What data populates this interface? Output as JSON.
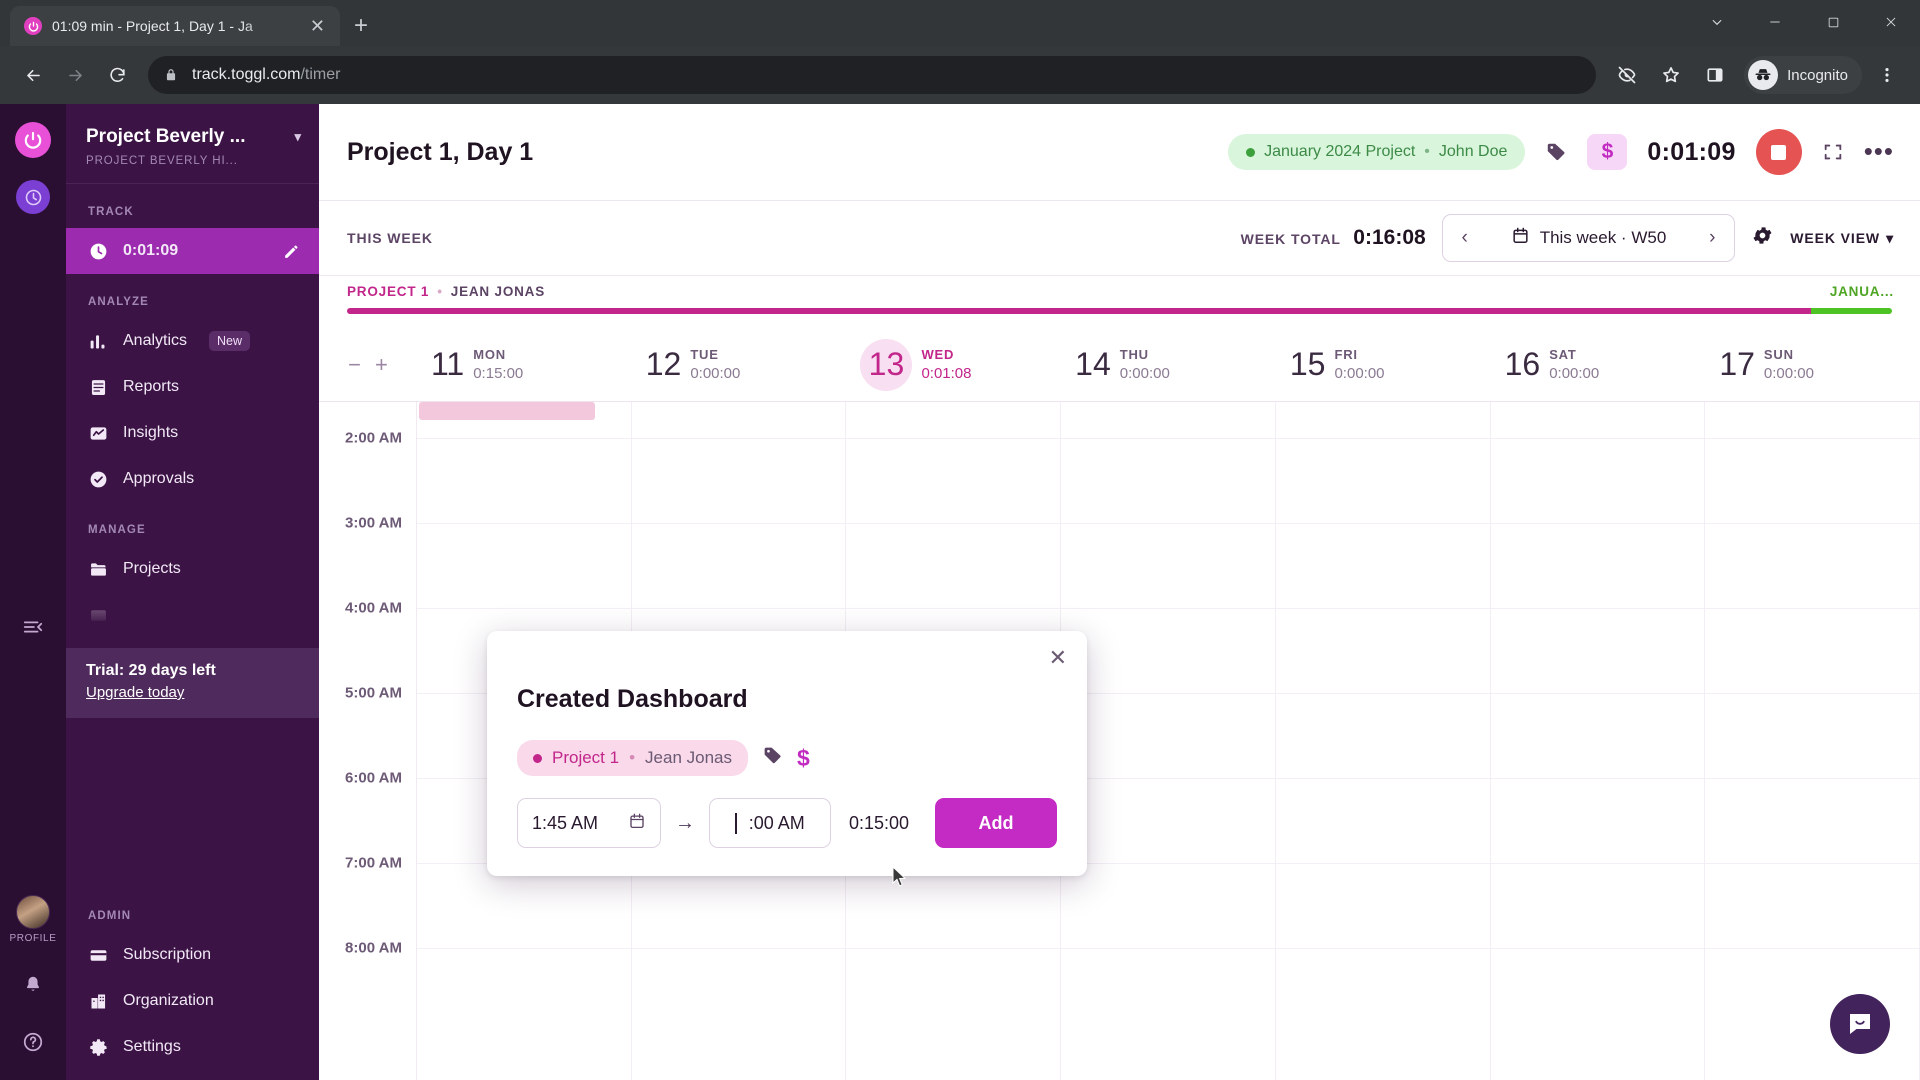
{
  "browser": {
    "tab": {
      "title": "01:09 min - Project 1, Day 1 - Ja",
      "favicon_icon": "toggl-power-icon",
      "close_icon": "close-icon"
    },
    "new_tab_icon": "plus-icon",
    "window_controls": {
      "minimize": "minimize-icon",
      "maximize": "maximize-icon",
      "close": "close-icon",
      "tab_search": "chevron-down-icon"
    },
    "nav": {
      "back": "back-arrow-icon",
      "forward": "forward-arrow-icon",
      "reload": "reload-icon"
    },
    "omnibox": {
      "lock_icon": "lock-icon",
      "url_host": "track.toggl.com",
      "url_path": "/timer"
    },
    "toolbar_icons": {
      "tracking_protection": "eye-off-icon",
      "bookmark": "star-icon",
      "side_panel": "side-panel-icon",
      "menu": "three-dot-menu-icon"
    },
    "profile": {
      "label": "Incognito",
      "icon": "incognito-icon"
    }
  },
  "rail": {
    "logo_icon": "toggl-power-icon",
    "app_switcher_icon": "toggl-track-icon",
    "collapse_icon": "collapse-sidebar-icon",
    "profile_caption": "PROFILE",
    "avatar_icon": "user-avatar",
    "notifications_icon": "bell-icon",
    "help_icon": "help-circle-icon"
  },
  "sidebar": {
    "workspace_title": "Project Beverly ...",
    "workspace_chevron": "chevron-down-icon",
    "workspace_subtitle": "PROJECT BEVERLY HI...",
    "sections": [
      {
        "label": "TRACK",
        "items": [
          {
            "label": "0:01:09",
            "icon": "clock-icon",
            "active": true,
            "trailing_icon": "pencil-icon"
          }
        ]
      },
      {
        "label": "ANALYZE",
        "items": [
          {
            "label": "Analytics",
            "icon": "bar-chart-icon",
            "badge": "New"
          },
          {
            "label": "Reports",
            "icon": "document-icon"
          },
          {
            "label": "Insights",
            "icon": "insights-icon"
          },
          {
            "label": "Approvals",
            "icon": "check-circle-icon"
          }
        ]
      },
      {
        "label": "MANAGE",
        "items": [
          {
            "label": "Projects",
            "icon": "folder-icon"
          }
        ]
      }
    ],
    "trial": {
      "text": "Trial: 29 days left",
      "link": "Upgrade today"
    },
    "admin": {
      "label": "ADMIN",
      "items": [
        {
          "label": "Subscription",
          "icon": "credit-card-icon"
        },
        {
          "label": "Organization",
          "icon": "building-icon"
        },
        {
          "label": "Settings",
          "icon": "gear-icon"
        }
      ]
    }
  },
  "app_header": {
    "entry_title": "Project 1, Day 1",
    "project_pill": {
      "project": "January 2024 Project",
      "separator": "•",
      "member": "John Doe",
      "dot_color": "#3ca03c"
    },
    "tag_icon": "tag-icon",
    "billable_icon": "dollar-icon",
    "timer": "0:01:09",
    "stop_icon": "stop-icon",
    "fullscreen_icon": "fullscreen-icon",
    "more_icon": "three-dot-menu-icon"
  },
  "week_bar": {
    "this_week_label": "THIS WEEK",
    "week_total_label": "WEEK TOTAL",
    "week_total_value": "0:16:08",
    "prev_icon": "chevron-left-icon",
    "next_icon": "chevron-right-icon",
    "calendar_icon": "calendar-icon",
    "picker_label": "This week · W50",
    "settings_icon": "gear-icon",
    "view_label": "WEEK VIEW",
    "view_chevron": "chevron-down-icon"
  },
  "project_strip": {
    "project": "PROJECT 1",
    "separator": "•",
    "member": "JEAN JONAS",
    "right_label": "JANUA...",
    "bar_primary_color": "#c2268a",
    "bar_secondary_color": "#4ec424"
  },
  "zoom_controls": {
    "out": "−",
    "in": "+"
  },
  "days": [
    {
      "num": "11",
      "dow": "MON",
      "dur": "0:15:00",
      "today": false
    },
    {
      "num": "12",
      "dow": "TUE",
      "dur": "0:00:00",
      "today": false
    },
    {
      "num": "13",
      "dow": "WED",
      "dur": "0:01:08",
      "today": true
    },
    {
      "num": "14",
      "dow": "THU",
      "dur": "0:00:00",
      "today": false
    },
    {
      "num": "15",
      "dow": "FRI",
      "dur": "0:00:00",
      "today": false
    },
    {
      "num": "16",
      "dow": "SAT",
      "dur": "0:00:00",
      "today": false
    },
    {
      "num": "17",
      "dow": "SUN",
      "dur": "0:00:00",
      "today": false
    }
  ],
  "time_labels": [
    "2:00 AM",
    "3:00 AM",
    "4:00 AM",
    "5:00 AM",
    "6:00 AM",
    "7:00 AM",
    "8:00 AM"
  ],
  "modal": {
    "close_icon": "close-icon",
    "title": "Created Dashboard",
    "project": "Project 1",
    "separator": "•",
    "member": "Jean Jonas",
    "tag_icon": "tag-icon",
    "billable_icon": "dollar-icon",
    "start_time": "1:45 AM",
    "start_calendar_icon": "calendar-icon",
    "arrow": "→",
    "end_time": ":00 AM",
    "duration": "0:15:00",
    "add_label": "Add"
  },
  "chat_widget": {
    "icon": "chat-bubble-icon"
  },
  "cursor": {
    "icon": "mouse-pointer"
  }
}
